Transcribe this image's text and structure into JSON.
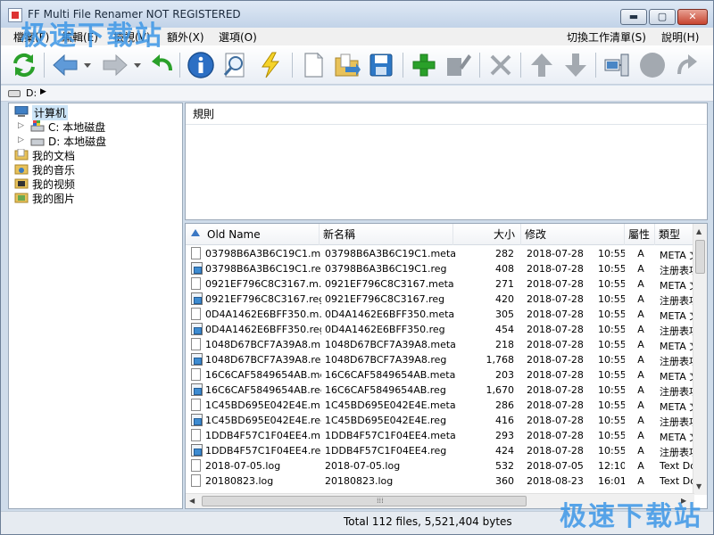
{
  "window": {
    "title": "FF Multi File Renamer NOT REGISTERED",
    "controls": {
      "minimize": "▬",
      "maximize": "▢",
      "close": "✕"
    }
  },
  "watermark": {
    "text": "极速下载站"
  },
  "menubar": {
    "items": [
      "檔案(F)",
      "編輯(E)",
      "檢視(V)",
      "額外(X)",
      "選項(O)"
    ],
    "right_items": [
      "切換工作清單(S)",
      "說明(H)"
    ]
  },
  "toolbar": {
    "buttons": [
      {
        "name": "refresh",
        "icon": "refresh-icon"
      },
      {
        "name": "back",
        "icon": "back-arrow-icon"
      },
      {
        "name": "forward",
        "icon": "forward-arrow-icon"
      },
      {
        "name": "undo",
        "icon": "undo-icon"
      },
      {
        "name": "info",
        "icon": "info-icon"
      },
      {
        "name": "preview",
        "icon": "magnifier-icon"
      },
      {
        "name": "execute",
        "icon": "lightning-icon"
      },
      {
        "name": "new",
        "icon": "new-file-icon"
      },
      {
        "name": "open",
        "icon": "open-folder-icon"
      },
      {
        "name": "save",
        "icon": "save-icon"
      },
      {
        "name": "add-rule",
        "icon": "plus-icon"
      },
      {
        "name": "edit-rule",
        "icon": "edit-icon"
      },
      {
        "name": "delete-rule",
        "icon": "delete-icon"
      },
      {
        "name": "move-up",
        "icon": "up-arrow-icon"
      },
      {
        "name": "move-down",
        "icon": "down-arrow-icon"
      },
      {
        "name": "settings",
        "icon": "network-icon"
      },
      {
        "name": "record",
        "icon": "circle-icon"
      },
      {
        "name": "redo",
        "icon": "redo-icon"
      }
    ]
  },
  "pathbar": {
    "path": "D:"
  },
  "tree": {
    "items": [
      {
        "label": "计算机",
        "icon": "computer-icon",
        "level": 0
      },
      {
        "label": "C: 本地磁盘",
        "icon": "drive-c-icon",
        "level": 1
      },
      {
        "label": "D: 本地磁盘",
        "icon": "drive-d-icon",
        "level": 1
      },
      {
        "label": "我的文档",
        "icon": "documents-icon",
        "level": 0
      },
      {
        "label": "我的音乐",
        "icon": "music-icon",
        "level": 0
      },
      {
        "label": "我的视频",
        "icon": "video-icon",
        "level": 0
      },
      {
        "label": "我的图片",
        "icon": "pictures-icon",
        "level": 0
      }
    ]
  },
  "rules": {
    "header": "規則"
  },
  "filelist": {
    "columns": [
      "Old Name",
      "新名稱",
      "大小",
      "修改",
      "屬性",
      "類型"
    ],
    "rows": [
      {
        "old": "03798B6A3B6C19C1.m...",
        "new": "03798B6A3B6C19C1.meta",
        "size": "282",
        "date": "2018-07-28",
        "time": "10:55",
        "attr": "A",
        "type": "META 文件",
        "icon": "file"
      },
      {
        "old": "03798B6A3B6C19C1.reg",
        "new": "03798B6A3B6C19C1.reg",
        "size": "408",
        "date": "2018-07-28",
        "time": "10:55",
        "attr": "A",
        "type": "注册表项",
        "icon": "reg"
      },
      {
        "old": "0921EF796C8C3167.m...",
        "new": "0921EF796C8C3167.meta",
        "size": "271",
        "date": "2018-07-28",
        "time": "10:55",
        "attr": "A",
        "type": "META 文件",
        "icon": "file"
      },
      {
        "old": "0921EF796C8C3167.reg",
        "new": "0921EF796C8C3167.reg",
        "size": "420",
        "date": "2018-07-28",
        "time": "10:55",
        "attr": "A",
        "type": "注册表项",
        "icon": "reg"
      },
      {
        "old": "0D4A1462E6BFF350.m...",
        "new": "0D4A1462E6BFF350.meta",
        "size": "305",
        "date": "2018-07-28",
        "time": "10:55",
        "attr": "A",
        "type": "META 文件",
        "icon": "file"
      },
      {
        "old": "0D4A1462E6BFF350.reg",
        "new": "0D4A1462E6BFF350.reg",
        "size": "454",
        "date": "2018-07-28",
        "time": "10:55",
        "attr": "A",
        "type": "注册表项",
        "icon": "reg"
      },
      {
        "old": "1048D67BCF7A39A8.m...",
        "new": "1048D67BCF7A39A8.meta",
        "size": "218",
        "date": "2018-07-28",
        "time": "10:55",
        "attr": "A",
        "type": "META 文件",
        "icon": "file"
      },
      {
        "old": "1048D67BCF7A39A8.reg",
        "new": "1048D67BCF7A39A8.reg",
        "size": "1,768",
        "date": "2018-07-28",
        "time": "10:55",
        "attr": "A",
        "type": "注册表项",
        "icon": "reg"
      },
      {
        "old": "16C6CAF5849654AB.meta",
        "new": "16C6CAF5849654AB.meta",
        "size": "203",
        "date": "2018-07-28",
        "time": "10:55",
        "attr": "A",
        "type": "META 文件",
        "icon": "file"
      },
      {
        "old": "16C6CAF5849654AB.reg",
        "new": "16C6CAF5849654AB.reg",
        "size": "1,670",
        "date": "2018-07-28",
        "time": "10:55",
        "attr": "A",
        "type": "注册表项",
        "icon": "reg"
      },
      {
        "old": "1C45BD695E042E4E.m...",
        "new": "1C45BD695E042E4E.meta",
        "size": "286",
        "date": "2018-07-28",
        "time": "10:55",
        "attr": "A",
        "type": "META 文件",
        "icon": "file"
      },
      {
        "old": "1C45BD695E042E4E.reg",
        "new": "1C45BD695E042E4E.reg",
        "size": "416",
        "date": "2018-07-28",
        "time": "10:55",
        "attr": "A",
        "type": "注册表项",
        "icon": "reg"
      },
      {
        "old": "1DDB4F57C1F04EE4.m...",
        "new": "1DDB4F57C1F04EE4.meta",
        "size": "293",
        "date": "2018-07-28",
        "time": "10:55",
        "attr": "A",
        "type": "META 文件",
        "icon": "file"
      },
      {
        "old": "1DDB4F57C1F04EE4.reg",
        "new": "1DDB4F57C1F04EE4.reg",
        "size": "424",
        "date": "2018-07-28",
        "time": "10:55",
        "attr": "A",
        "type": "注册表项",
        "icon": "reg"
      },
      {
        "old": "2018-07-05.log",
        "new": "2018-07-05.log",
        "size": "532",
        "date": "2018-07-05",
        "time": "12:10",
        "attr": "A",
        "type": "Text Document",
        "icon": "file"
      },
      {
        "old": "20180823.log",
        "new": "20180823.log",
        "size": "360",
        "date": "2018-08-23",
        "time": "16:01",
        "attr": "A",
        "type": "Text Document",
        "icon": "file"
      }
    ]
  },
  "statusbar": {
    "text": "Total 112 files, 5,521,404 bytes"
  },
  "colors": {
    "accent": "#2f78c8",
    "toolbar_green": "#2aa02a",
    "titlebar": "#c2d3e8"
  }
}
